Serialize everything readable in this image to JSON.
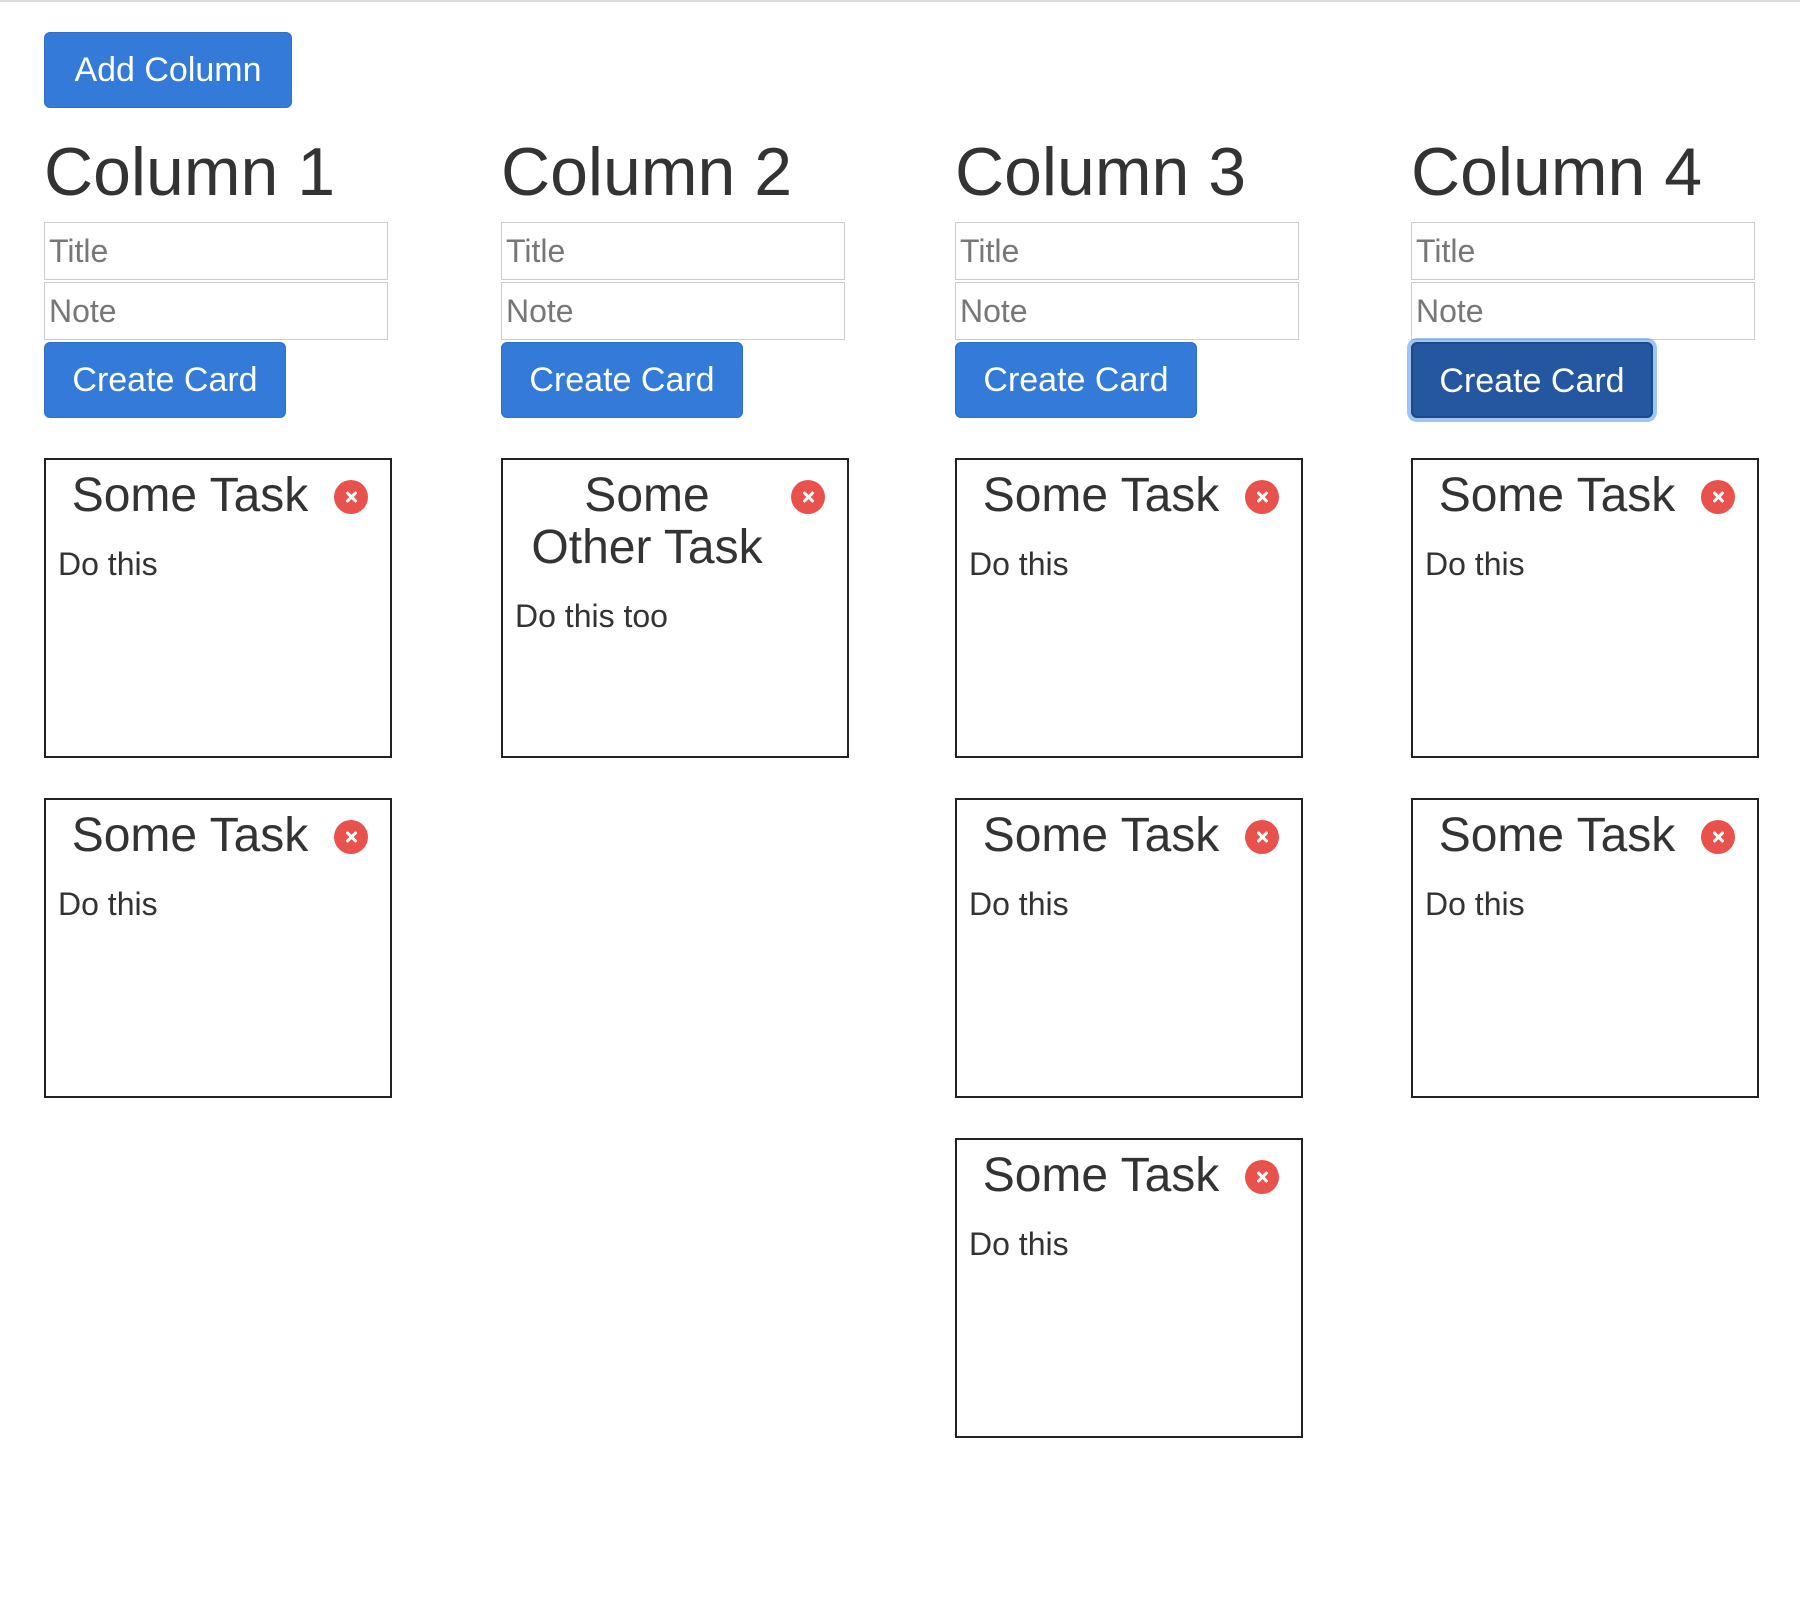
{
  "toolbar": {
    "add_column_label": "Add Column"
  },
  "colors": {
    "primary": "#337ad9",
    "primary_active": "#24579f",
    "danger": "#e8514c",
    "text": "#333333",
    "card_border": "#222222"
  },
  "columns": [
    {
      "title": "Column 1",
      "title_placeholder": "Title",
      "note_placeholder": "Note",
      "title_value": "",
      "note_value": "",
      "create_label": "Create Card",
      "cards": [
        {
          "title": "Some Task",
          "note": "Do this",
          "icon": "close-icon"
        },
        {
          "title": "Some Task",
          "note": "Do this",
          "icon": "close-icon"
        }
      ]
    },
    {
      "title": "Column 2",
      "title_placeholder": "Title",
      "note_placeholder": "Note",
      "title_value": "",
      "note_value": "",
      "create_label": "Create Card",
      "cards": [
        {
          "title": "Some Other Task",
          "note": "Do this too",
          "icon": "close-icon"
        }
      ]
    },
    {
      "title": "Column 3",
      "title_placeholder": "Title",
      "note_placeholder": "Note",
      "title_value": "",
      "note_value": "",
      "create_label": "Create Card",
      "cards": [
        {
          "title": "Some Task",
          "note": "Do this",
          "icon": "close-icon"
        },
        {
          "title": "Some Task",
          "note": "Do this",
          "icon": "close-icon"
        },
        {
          "title": "Some Task",
          "note": "Do this",
          "icon": "close-icon"
        }
      ]
    },
    {
      "title": "Column 4",
      "title_placeholder": "Title",
      "note_placeholder": "Note",
      "title_value": "",
      "note_value": "",
      "create_label": "Create Card",
      "create_focused": true,
      "cards": [
        {
          "title": "Some Task",
          "note": "Do this",
          "icon": "close-icon"
        },
        {
          "title": "Some Task",
          "note": "Do this",
          "icon": "close-icon"
        }
      ]
    }
  ]
}
